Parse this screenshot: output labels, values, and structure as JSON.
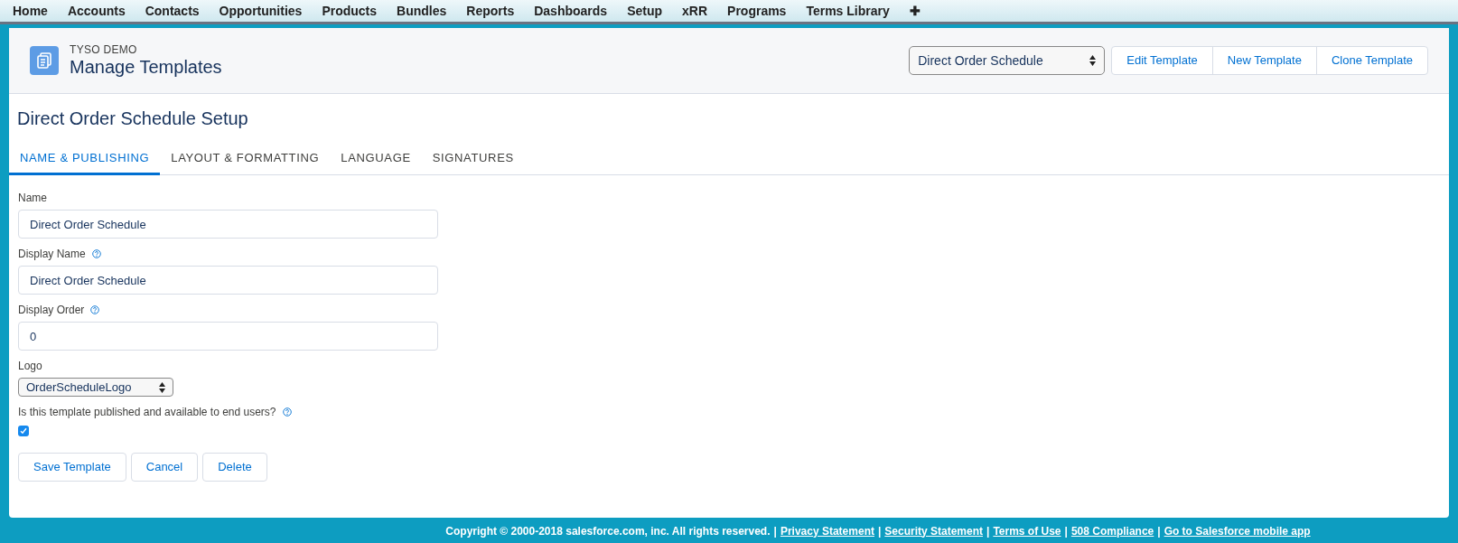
{
  "nav": {
    "items": [
      {
        "label": "Home"
      },
      {
        "label": "Accounts"
      },
      {
        "label": "Contacts"
      },
      {
        "label": "Opportunities"
      },
      {
        "label": "Products"
      },
      {
        "label": "Bundles"
      },
      {
        "label": "Reports"
      },
      {
        "label": "Dashboards"
      },
      {
        "label": "Setup"
      },
      {
        "label": "xRR"
      },
      {
        "label": "Programs"
      },
      {
        "label": "Terms Library"
      },
      {
        "label": "✚"
      }
    ]
  },
  "header": {
    "eyebrow": "TYSO DEMO",
    "title": "Manage Templates",
    "template_select": "Direct Order Schedule",
    "buttons": [
      "Edit Template",
      "New Template",
      "Clone Template"
    ]
  },
  "page_title": "Direct Order Schedule Setup",
  "tabs": [
    {
      "label": "NAME & PUBLISHING",
      "selected": true
    },
    {
      "label": "LAYOUT & FORMATTING",
      "selected": false
    },
    {
      "label": "LANGUAGE",
      "selected": false
    },
    {
      "label": "SIGNATURES",
      "selected": false
    }
  ],
  "fields": [
    {
      "kind": "text",
      "label": "Name",
      "help": false,
      "value": "Direct Order Schedule"
    },
    {
      "kind": "text",
      "label": "Display Name",
      "help": true,
      "value": "Direct Order Schedule"
    },
    {
      "kind": "text",
      "label": "Display Order",
      "help": true,
      "value": "0"
    },
    {
      "kind": "select",
      "label": "Logo",
      "help": false,
      "value": "OrderScheduleLogo"
    },
    {
      "kind": "checkbox",
      "label": "Is this template published and available to end users?",
      "help": true,
      "checked": true
    }
  ],
  "buttons": [
    "Save Template",
    "Cancel",
    "Delete"
  ],
  "footer": [
    {
      "kind": "text",
      "text": "Copyright © 2000-2018 salesforce.com, inc. All rights reserved."
    },
    {
      "kind": "separator",
      "text": "|"
    },
    {
      "kind": "link",
      "text": "Privacy Statement"
    },
    {
      "kind": "separator",
      "text": "|"
    },
    {
      "kind": "link",
      "text": "Security Statement"
    },
    {
      "kind": "separator",
      "text": "|"
    },
    {
      "kind": "link",
      "text": "Terms of Use"
    },
    {
      "kind": "separator",
      "text": "|"
    },
    {
      "kind": "link",
      "text": "508 Compliance"
    },
    {
      "kind": "separator",
      "text": "|"
    },
    {
      "kind": "link",
      "text": "Go to Salesforce mobile app"
    }
  ]
}
